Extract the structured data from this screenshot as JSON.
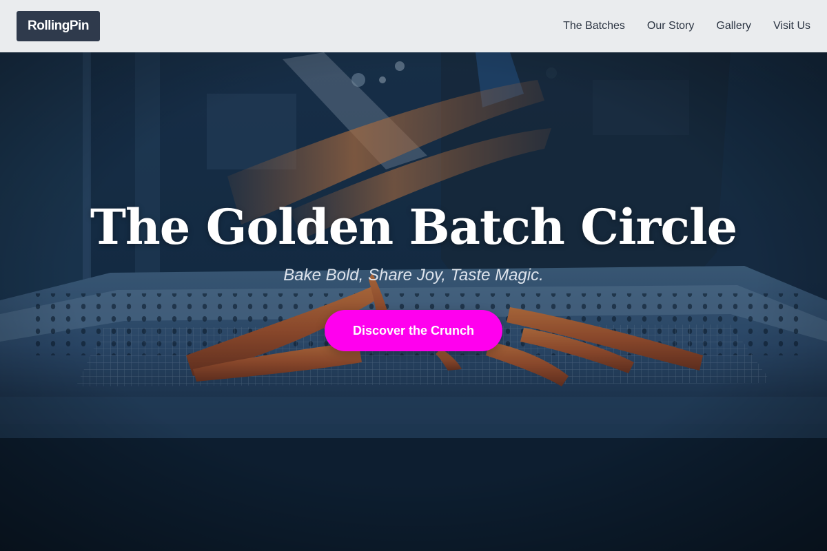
{
  "header": {
    "logo": "RollingPin",
    "nav": [
      {
        "label": "The Batches"
      },
      {
        "label": "Our Story"
      },
      {
        "label": "Gallery"
      },
      {
        "label": "Visit Us"
      }
    ]
  },
  "hero": {
    "title": "The Golden Batch Circle",
    "subtitle": "Bake Bold, Share Joy, Taste Magic.",
    "cta_label": "Discover the Crunch"
  },
  "colors": {
    "header_bg": "#f4f5f7",
    "logo_bg": "#2f3a4c",
    "cta_bg": "#ff00ee",
    "hero_overlay": "#0c1d2e"
  }
}
